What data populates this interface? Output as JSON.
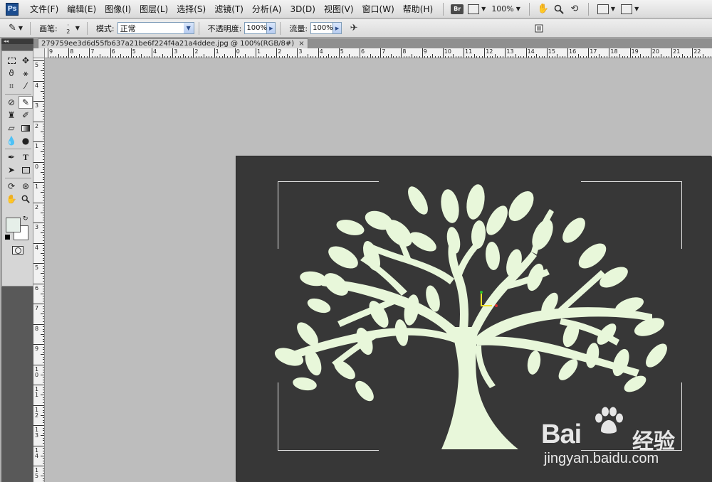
{
  "app": {
    "logo_text": "Ps"
  },
  "menu": {
    "items": [
      "文件(F)",
      "编辑(E)",
      "图像(I)",
      "图层(L)",
      "选择(S)",
      "滤镜(T)",
      "分析(A)",
      "3D(D)",
      "视图(V)",
      "窗口(W)",
      "帮助(H)"
    ],
    "bridge_badge": "Br",
    "zoom_value": "100%"
  },
  "options": {
    "brush_label": "画笔:",
    "brush_size": "2",
    "mode_label": "模式:",
    "mode_value": "正常",
    "opacity_label": "不透明度:",
    "opacity_value": "100%",
    "flow_label": "流量:",
    "flow_value": "100%"
  },
  "document": {
    "tab_title": "279759ee3d6d55fb637a21be6f224f4a21a4ddee.jpg @ 100%(RGB/8#)",
    "close_glyph": "×",
    "background_color": "#373737",
    "tree_color": "#e8f7da"
  },
  "rulers": {
    "horizontal_labels": [
      "9",
      "8",
      "7",
      "6",
      "5",
      "4",
      "3",
      "2",
      "1",
      "0",
      "1",
      "2",
      "3",
      "4",
      "5",
      "6",
      "7",
      "8",
      "9",
      "10",
      "11",
      "12",
      "13",
      "14",
      "15",
      "16",
      "17",
      "18",
      "19",
      "20",
      "21",
      "22"
    ],
    "vertical_labels": [
      "5",
      "4",
      "3",
      "2",
      "1",
      "0",
      "1",
      "2",
      "3",
      "4",
      "5",
      "6",
      "7",
      "8",
      "9",
      "10",
      "11",
      "12",
      "13",
      "14",
      "15",
      "16"
    ]
  },
  "colors": {
    "foreground": "#e6efe9",
    "background": "#ffffff"
  },
  "watermark": {
    "brand": "Bai",
    "brand_suffix": "经验",
    "url": "jingyan.baidu.com"
  }
}
